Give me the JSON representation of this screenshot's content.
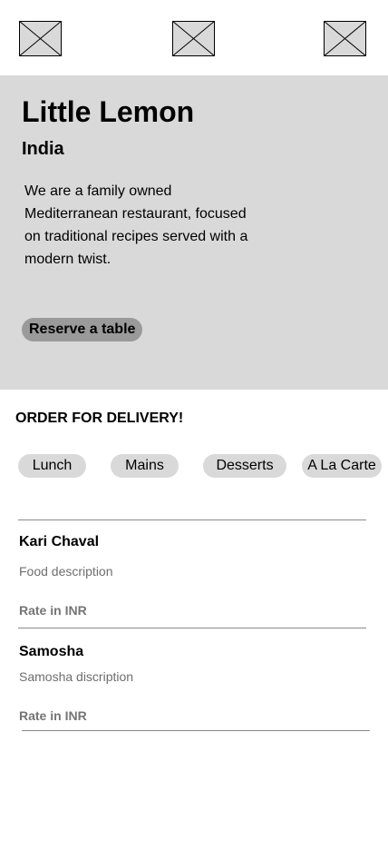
{
  "header": {
    "left_icon": "image-placeholder-icon",
    "center_icon": "image-placeholder-icon",
    "right_icon": "image-placeholder-icon"
  },
  "hero": {
    "title": "Little Lemon",
    "subtitle": "India",
    "description": "We are a family owned Mediterranean restaurant, focused on traditional recipes served with a modern twist.",
    "reserve_label": "Reserve a table"
  },
  "delivery": {
    "heading": "ORDER FOR DELIVERY!",
    "categories": [
      "Lunch",
      "Mains",
      "Desserts",
      "A La Carte"
    ]
  },
  "menu": {
    "items": [
      {
        "name": "Kari Chaval",
        "description": "Food description",
        "rate": "Rate in INR"
      },
      {
        "name": "Samosha",
        "description": "Samosha discription",
        "rate": "Rate in INR"
      }
    ]
  },
  "colors": {
    "hero_background": "#d9d9d9",
    "reserve_button": "#9a9a9a",
    "chip_background": "#d9d9d9",
    "muted_text": "#6e6e6e"
  }
}
